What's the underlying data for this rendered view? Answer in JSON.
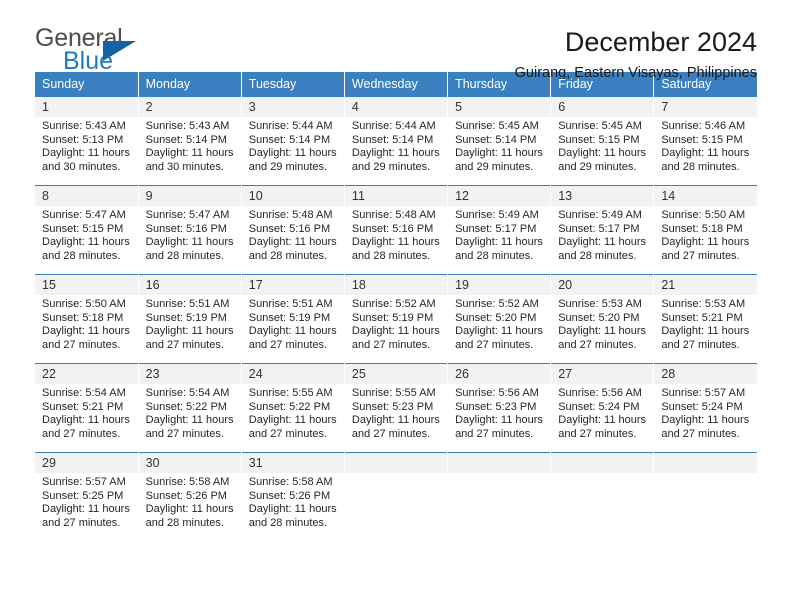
{
  "brand": {
    "name_top": "General",
    "name_bottom": "Blue",
    "triangle_icon": "blue-triangle-icon",
    "color_top": "#4d4d4d",
    "color_bottom": "#1f7ac4"
  },
  "header": {
    "title": "December 2024",
    "subtitle": "Guirang, Eastern Visayas, Philippines"
  },
  "theme": {
    "header_bg": "#3a7fc0",
    "header_text": "#ffffff",
    "daynum_bg": "#f2f2f2",
    "row_border": "#3a7fc0"
  },
  "weekdays": [
    "Sunday",
    "Monday",
    "Tuesday",
    "Wednesday",
    "Thursday",
    "Friday",
    "Saturday"
  ],
  "weeks": [
    [
      {
        "day": "1",
        "sunrise": "Sunrise: 5:43 AM",
        "sunset": "Sunset: 5:13 PM",
        "daylight1": "Daylight: 11 hours",
        "daylight2": "and 30 minutes."
      },
      {
        "day": "2",
        "sunrise": "Sunrise: 5:43 AM",
        "sunset": "Sunset: 5:14 PM",
        "daylight1": "Daylight: 11 hours",
        "daylight2": "and 30 minutes."
      },
      {
        "day": "3",
        "sunrise": "Sunrise: 5:44 AM",
        "sunset": "Sunset: 5:14 PM",
        "daylight1": "Daylight: 11 hours",
        "daylight2": "and 29 minutes."
      },
      {
        "day": "4",
        "sunrise": "Sunrise: 5:44 AM",
        "sunset": "Sunset: 5:14 PM",
        "daylight1": "Daylight: 11 hours",
        "daylight2": "and 29 minutes."
      },
      {
        "day": "5",
        "sunrise": "Sunrise: 5:45 AM",
        "sunset": "Sunset: 5:14 PM",
        "daylight1": "Daylight: 11 hours",
        "daylight2": "and 29 minutes."
      },
      {
        "day": "6",
        "sunrise": "Sunrise: 5:45 AM",
        "sunset": "Sunset: 5:15 PM",
        "daylight1": "Daylight: 11 hours",
        "daylight2": "and 29 minutes."
      },
      {
        "day": "7",
        "sunrise": "Sunrise: 5:46 AM",
        "sunset": "Sunset: 5:15 PM",
        "daylight1": "Daylight: 11 hours",
        "daylight2": "and 28 minutes."
      }
    ],
    [
      {
        "day": "8",
        "sunrise": "Sunrise: 5:47 AM",
        "sunset": "Sunset: 5:15 PM",
        "daylight1": "Daylight: 11 hours",
        "daylight2": "and 28 minutes."
      },
      {
        "day": "9",
        "sunrise": "Sunrise: 5:47 AM",
        "sunset": "Sunset: 5:16 PM",
        "daylight1": "Daylight: 11 hours",
        "daylight2": "and 28 minutes."
      },
      {
        "day": "10",
        "sunrise": "Sunrise: 5:48 AM",
        "sunset": "Sunset: 5:16 PM",
        "daylight1": "Daylight: 11 hours",
        "daylight2": "and 28 minutes."
      },
      {
        "day": "11",
        "sunrise": "Sunrise: 5:48 AM",
        "sunset": "Sunset: 5:16 PM",
        "daylight1": "Daylight: 11 hours",
        "daylight2": "and 28 minutes."
      },
      {
        "day": "12",
        "sunrise": "Sunrise: 5:49 AM",
        "sunset": "Sunset: 5:17 PM",
        "daylight1": "Daylight: 11 hours",
        "daylight2": "and 28 minutes."
      },
      {
        "day": "13",
        "sunrise": "Sunrise: 5:49 AM",
        "sunset": "Sunset: 5:17 PM",
        "daylight1": "Daylight: 11 hours",
        "daylight2": "and 28 minutes."
      },
      {
        "day": "14",
        "sunrise": "Sunrise: 5:50 AM",
        "sunset": "Sunset: 5:18 PM",
        "daylight1": "Daylight: 11 hours",
        "daylight2": "and 27 minutes."
      }
    ],
    [
      {
        "day": "15",
        "sunrise": "Sunrise: 5:50 AM",
        "sunset": "Sunset: 5:18 PM",
        "daylight1": "Daylight: 11 hours",
        "daylight2": "and 27 minutes."
      },
      {
        "day": "16",
        "sunrise": "Sunrise: 5:51 AM",
        "sunset": "Sunset: 5:19 PM",
        "daylight1": "Daylight: 11 hours",
        "daylight2": "and 27 minutes."
      },
      {
        "day": "17",
        "sunrise": "Sunrise: 5:51 AM",
        "sunset": "Sunset: 5:19 PM",
        "daylight1": "Daylight: 11 hours",
        "daylight2": "and 27 minutes."
      },
      {
        "day": "18",
        "sunrise": "Sunrise: 5:52 AM",
        "sunset": "Sunset: 5:19 PM",
        "daylight1": "Daylight: 11 hours",
        "daylight2": "and 27 minutes."
      },
      {
        "day": "19",
        "sunrise": "Sunrise: 5:52 AM",
        "sunset": "Sunset: 5:20 PM",
        "daylight1": "Daylight: 11 hours",
        "daylight2": "and 27 minutes."
      },
      {
        "day": "20",
        "sunrise": "Sunrise: 5:53 AM",
        "sunset": "Sunset: 5:20 PM",
        "daylight1": "Daylight: 11 hours",
        "daylight2": "and 27 minutes."
      },
      {
        "day": "21",
        "sunrise": "Sunrise: 5:53 AM",
        "sunset": "Sunset: 5:21 PM",
        "daylight1": "Daylight: 11 hours",
        "daylight2": "and 27 minutes."
      }
    ],
    [
      {
        "day": "22",
        "sunrise": "Sunrise: 5:54 AM",
        "sunset": "Sunset: 5:21 PM",
        "daylight1": "Daylight: 11 hours",
        "daylight2": "and 27 minutes."
      },
      {
        "day": "23",
        "sunrise": "Sunrise: 5:54 AM",
        "sunset": "Sunset: 5:22 PM",
        "daylight1": "Daylight: 11 hours",
        "daylight2": "and 27 minutes."
      },
      {
        "day": "24",
        "sunrise": "Sunrise: 5:55 AM",
        "sunset": "Sunset: 5:22 PM",
        "daylight1": "Daylight: 11 hours",
        "daylight2": "and 27 minutes."
      },
      {
        "day": "25",
        "sunrise": "Sunrise: 5:55 AM",
        "sunset": "Sunset: 5:23 PM",
        "daylight1": "Daylight: 11 hours",
        "daylight2": "and 27 minutes."
      },
      {
        "day": "26",
        "sunrise": "Sunrise: 5:56 AM",
        "sunset": "Sunset: 5:23 PM",
        "daylight1": "Daylight: 11 hours",
        "daylight2": "and 27 minutes."
      },
      {
        "day": "27",
        "sunrise": "Sunrise: 5:56 AM",
        "sunset": "Sunset: 5:24 PM",
        "daylight1": "Daylight: 11 hours",
        "daylight2": "and 27 minutes."
      },
      {
        "day": "28",
        "sunrise": "Sunrise: 5:57 AM",
        "sunset": "Sunset: 5:24 PM",
        "daylight1": "Daylight: 11 hours",
        "daylight2": "and 27 minutes."
      }
    ],
    [
      {
        "day": "29",
        "sunrise": "Sunrise: 5:57 AM",
        "sunset": "Sunset: 5:25 PM",
        "daylight1": "Daylight: 11 hours",
        "daylight2": "and 27 minutes."
      },
      {
        "day": "30",
        "sunrise": "Sunrise: 5:58 AM",
        "sunset": "Sunset: 5:26 PM",
        "daylight1": "Daylight: 11 hours",
        "daylight2": "and 28 minutes."
      },
      {
        "day": "31",
        "sunrise": "Sunrise: 5:58 AM",
        "sunset": "Sunset: 5:26 PM",
        "daylight1": "Daylight: 11 hours",
        "daylight2": "and 28 minutes."
      },
      {
        "day": "",
        "sunrise": "",
        "sunset": "",
        "daylight1": "",
        "daylight2": ""
      },
      {
        "day": "",
        "sunrise": "",
        "sunset": "",
        "daylight1": "",
        "daylight2": ""
      },
      {
        "day": "",
        "sunrise": "",
        "sunset": "",
        "daylight1": "",
        "daylight2": ""
      },
      {
        "day": "",
        "sunrise": "",
        "sunset": "",
        "daylight1": "",
        "daylight2": ""
      }
    ]
  ]
}
